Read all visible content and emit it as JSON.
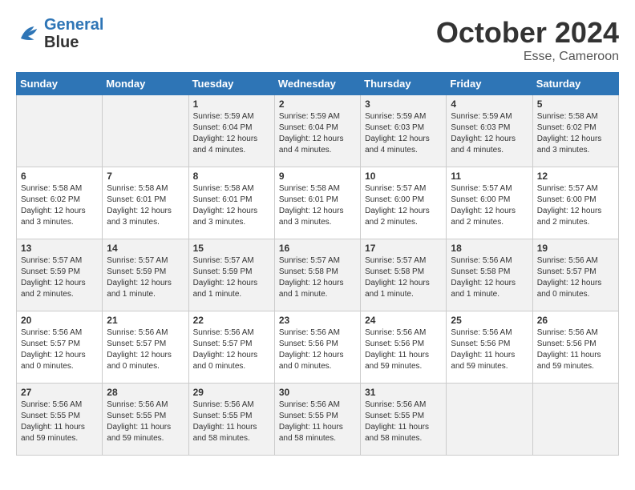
{
  "header": {
    "logo_line1": "General",
    "logo_line2": "Blue",
    "month": "October 2024",
    "location": "Esse, Cameroon"
  },
  "weekdays": [
    "Sunday",
    "Monday",
    "Tuesday",
    "Wednesday",
    "Thursday",
    "Friday",
    "Saturday"
  ],
  "rows": [
    [
      {
        "num": "",
        "info": ""
      },
      {
        "num": "",
        "info": ""
      },
      {
        "num": "1",
        "info": "Sunrise: 5:59 AM\nSunset: 6:04 PM\nDaylight: 12 hours\nand 4 minutes."
      },
      {
        "num": "2",
        "info": "Sunrise: 5:59 AM\nSunset: 6:04 PM\nDaylight: 12 hours\nand 4 minutes."
      },
      {
        "num": "3",
        "info": "Sunrise: 5:59 AM\nSunset: 6:03 PM\nDaylight: 12 hours\nand 4 minutes."
      },
      {
        "num": "4",
        "info": "Sunrise: 5:59 AM\nSunset: 6:03 PM\nDaylight: 12 hours\nand 4 minutes."
      },
      {
        "num": "5",
        "info": "Sunrise: 5:58 AM\nSunset: 6:02 PM\nDaylight: 12 hours\nand 3 minutes."
      }
    ],
    [
      {
        "num": "6",
        "info": "Sunrise: 5:58 AM\nSunset: 6:02 PM\nDaylight: 12 hours\nand 3 minutes."
      },
      {
        "num": "7",
        "info": "Sunrise: 5:58 AM\nSunset: 6:01 PM\nDaylight: 12 hours\nand 3 minutes."
      },
      {
        "num": "8",
        "info": "Sunrise: 5:58 AM\nSunset: 6:01 PM\nDaylight: 12 hours\nand 3 minutes."
      },
      {
        "num": "9",
        "info": "Sunrise: 5:58 AM\nSunset: 6:01 PM\nDaylight: 12 hours\nand 3 minutes."
      },
      {
        "num": "10",
        "info": "Sunrise: 5:57 AM\nSunset: 6:00 PM\nDaylight: 12 hours\nand 2 minutes."
      },
      {
        "num": "11",
        "info": "Sunrise: 5:57 AM\nSunset: 6:00 PM\nDaylight: 12 hours\nand 2 minutes."
      },
      {
        "num": "12",
        "info": "Sunrise: 5:57 AM\nSunset: 6:00 PM\nDaylight: 12 hours\nand 2 minutes."
      }
    ],
    [
      {
        "num": "13",
        "info": "Sunrise: 5:57 AM\nSunset: 5:59 PM\nDaylight: 12 hours\nand 2 minutes."
      },
      {
        "num": "14",
        "info": "Sunrise: 5:57 AM\nSunset: 5:59 PM\nDaylight: 12 hours\nand 1 minute."
      },
      {
        "num": "15",
        "info": "Sunrise: 5:57 AM\nSunset: 5:59 PM\nDaylight: 12 hours\nand 1 minute."
      },
      {
        "num": "16",
        "info": "Sunrise: 5:57 AM\nSunset: 5:58 PM\nDaylight: 12 hours\nand 1 minute."
      },
      {
        "num": "17",
        "info": "Sunrise: 5:57 AM\nSunset: 5:58 PM\nDaylight: 12 hours\nand 1 minute."
      },
      {
        "num": "18",
        "info": "Sunrise: 5:56 AM\nSunset: 5:58 PM\nDaylight: 12 hours\nand 1 minute."
      },
      {
        "num": "19",
        "info": "Sunrise: 5:56 AM\nSunset: 5:57 PM\nDaylight: 12 hours\nand 0 minutes."
      }
    ],
    [
      {
        "num": "20",
        "info": "Sunrise: 5:56 AM\nSunset: 5:57 PM\nDaylight: 12 hours\nand 0 minutes."
      },
      {
        "num": "21",
        "info": "Sunrise: 5:56 AM\nSunset: 5:57 PM\nDaylight: 12 hours\nand 0 minutes."
      },
      {
        "num": "22",
        "info": "Sunrise: 5:56 AM\nSunset: 5:57 PM\nDaylight: 12 hours\nand 0 minutes."
      },
      {
        "num": "23",
        "info": "Sunrise: 5:56 AM\nSunset: 5:56 PM\nDaylight: 12 hours\nand 0 minutes."
      },
      {
        "num": "24",
        "info": "Sunrise: 5:56 AM\nSunset: 5:56 PM\nDaylight: 11 hours\nand 59 minutes."
      },
      {
        "num": "25",
        "info": "Sunrise: 5:56 AM\nSunset: 5:56 PM\nDaylight: 11 hours\nand 59 minutes."
      },
      {
        "num": "26",
        "info": "Sunrise: 5:56 AM\nSunset: 5:56 PM\nDaylight: 11 hours\nand 59 minutes."
      }
    ],
    [
      {
        "num": "27",
        "info": "Sunrise: 5:56 AM\nSunset: 5:55 PM\nDaylight: 11 hours\nand 59 minutes."
      },
      {
        "num": "28",
        "info": "Sunrise: 5:56 AM\nSunset: 5:55 PM\nDaylight: 11 hours\nand 59 minutes."
      },
      {
        "num": "29",
        "info": "Sunrise: 5:56 AM\nSunset: 5:55 PM\nDaylight: 11 hours\nand 58 minutes."
      },
      {
        "num": "30",
        "info": "Sunrise: 5:56 AM\nSunset: 5:55 PM\nDaylight: 11 hours\nand 58 minutes."
      },
      {
        "num": "31",
        "info": "Sunrise: 5:56 AM\nSunset: 5:55 PM\nDaylight: 11 hours\nand 58 minutes."
      },
      {
        "num": "",
        "info": ""
      },
      {
        "num": "",
        "info": ""
      }
    ]
  ]
}
